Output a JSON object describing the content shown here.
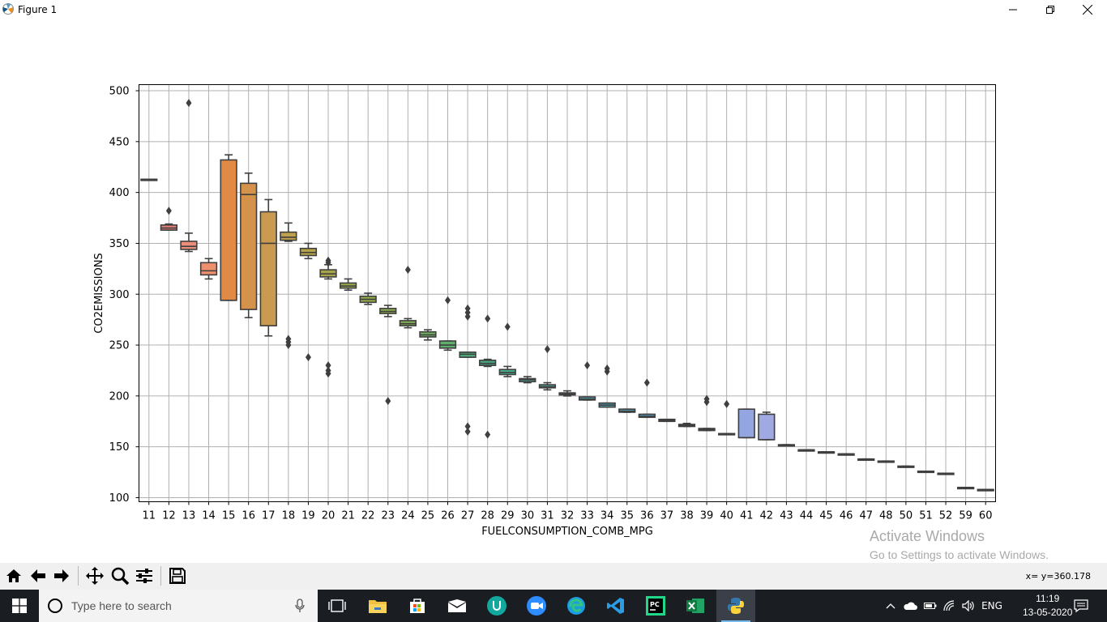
{
  "window": {
    "title": "Figure 1"
  },
  "toolbar": {
    "buttons": [
      "home-icon",
      "back-arrow-icon",
      "forward-arrow-icon",
      "pan-icon",
      "zoom-icon",
      "configure-subplots-icon",
      "save-icon"
    ],
    "coords": "x= y=360.178"
  },
  "watermark": {
    "line1": "Activate Windows",
    "line2": "Go to Settings to activate Windows."
  },
  "taskbar": {
    "search_placeholder": "Type here to search",
    "apps": [
      "task-view-icon",
      "file-explorer-icon",
      "store-icon",
      "mail-icon",
      "upwork-icon",
      "zoom-app-icon",
      "edge-icon",
      "vscode-icon",
      "pycharm-icon",
      "excel-icon",
      "python-icon"
    ],
    "language": "ENG",
    "time": "11:19",
    "date": "13-05-2020"
  },
  "chart_data": {
    "type": "box",
    "xlabel": "FUELCONSUMPTION_COMB_MPG",
    "ylabel": "CO2EMISSIONS",
    "ylim": [
      96,
      506
    ],
    "yticks": [
      100,
      150,
      200,
      250,
      300,
      350,
      400,
      450,
      500
    ],
    "grid": true,
    "categories": [
      "11",
      "12",
      "13",
      "14",
      "15",
      "16",
      "17",
      "18",
      "19",
      "20",
      "21",
      "22",
      "23",
      "24",
      "25",
      "26",
      "27",
      "28",
      "29",
      "30",
      "31",
      "32",
      "33",
      "34",
      "35",
      "36",
      "37",
      "38",
      "39",
      "40",
      "41",
      "42",
      "43",
      "44",
      "45",
      "46",
      "47",
      "48",
      "50",
      "51",
      "52",
      "59",
      "60"
    ],
    "boxes": [
      {
        "q1": 412,
        "median": 412,
        "q3": 413,
        "lo": 412,
        "hi": 413,
        "outliers": [],
        "color": "#dc5454"
      },
      {
        "q1": 363,
        "median": 365,
        "q3": 368,
        "lo": 363,
        "hi": 369,
        "outliers": [
          382
        ],
        "color": "#e8807a"
      },
      {
        "q1": 344,
        "median": 347,
        "q3": 352,
        "lo": 342,
        "hi": 360,
        "outliers": [
          488
        ],
        "color": "#ec8c7a"
      },
      {
        "q1": 319,
        "median": 323,
        "q3": 331,
        "lo": 315,
        "hi": 335,
        "outliers": [],
        "color": "#ee8f6e"
      },
      {
        "q1": 294,
        "median": 294,
        "q3": 432,
        "lo": 294,
        "hi": 437,
        "outliers": [],
        "color": "#e08a45"
      },
      {
        "q1": 285,
        "median": 398,
        "q3": 409,
        "lo": 277,
        "hi": 419,
        "outliers": [],
        "color": "#d4924b"
      },
      {
        "q1": 269,
        "median": 350,
        "q3": 381,
        "lo": 259,
        "hi": 393,
        "outliers": [],
        "color": "#c99a4f"
      },
      {
        "q1": 353,
        "median": 356,
        "q3": 361,
        "lo": 352,
        "hi": 370,
        "outliers": [
          250,
          253,
          256
        ],
        "color": "#c0a04c"
      },
      {
        "q1": 338,
        "median": 341,
        "q3": 345,
        "lo": 335,
        "hi": 350,
        "outliers": [
          238
        ],
        "color": "#b5a347"
      },
      {
        "q1": 317,
        "median": 320,
        "q3": 324,
        "lo": 315,
        "hi": 329,
        "outliers": [
          222,
          225,
          230,
          331,
          333
        ],
        "color": "#a8a549"
      },
      {
        "q1": 306,
        "median": 308,
        "q3": 311,
        "lo": 304,
        "hi": 315,
        "outliers": [],
        "color": "#9ea749"
      },
      {
        "q1": 292,
        "median": 295,
        "q3": 298,
        "lo": 290,
        "hi": 301,
        "outliers": [],
        "color": "#94a948"
      },
      {
        "q1": 281,
        "median": 283,
        "q3": 286,
        "lo": 278,
        "hi": 289,
        "outliers": [
          195
        ],
        "color": "#8aab4c"
      },
      {
        "q1": 269,
        "median": 271,
        "q3": 274,
        "lo": 267,
        "hi": 276,
        "outliers": [
          324
        ],
        "color": "#7fad51"
      },
      {
        "q1": 258,
        "median": 260,
        "q3": 263,
        "lo": 255,
        "hi": 265,
        "outliers": [],
        "color": "#6fae5e"
      },
      {
        "q1": 247,
        "median": 250,
        "q3": 254,
        "lo": 245,
        "hi": 254,
        "outliers": [
          294
        ],
        "color": "#5eaf6d"
      },
      {
        "q1": 238,
        "median": 241,
        "q3": 243,
        "lo": 238,
        "hi": 243,
        "outliers": [
          165,
          170,
          278,
          282,
          286
        ],
        "color": "#4fae7a"
      },
      {
        "q1": 230,
        "median": 232,
        "q3": 235,
        "lo": 229,
        "hi": 236,
        "outliers": [
          162,
          276
        ],
        "color": "#47ac84"
      },
      {
        "q1": 221,
        "median": 223,
        "q3": 226,
        "lo": 219,
        "hi": 229,
        "outliers": [
          268
        ],
        "color": "#44ab8d"
      },
      {
        "q1": 214,
        "median": 216,
        "q3": 217,
        "lo": 213,
        "hi": 219,
        "outliers": [],
        "color": "#45aa96"
      },
      {
        "q1": 208,
        "median": 209,
        "q3": 211,
        "lo": 206,
        "hi": 213,
        "outliers": [
          246
        ],
        "color": "#47a99e"
      },
      {
        "q1": 201,
        "median": 202,
        "q3": 203,
        "lo": 200,
        "hi": 205,
        "outliers": [],
        "color": "#48a7a7"
      },
      {
        "q1": 196,
        "median": 197,
        "q3": 199,
        "lo": 196,
        "hi": 199,
        "outliers": [
          230
        ],
        "color": "#4aa5ae"
      },
      {
        "q1": 189,
        "median": 191,
        "q3": 193,
        "lo": 189,
        "hi": 193,
        "outliers": [
          224,
          227
        ],
        "color": "#4ca3b5"
      },
      {
        "q1": 184,
        "median": 185,
        "q3": 187,
        "lo": 184,
        "hi": 187,
        "outliers": [],
        "color": "#50a1bd"
      },
      {
        "q1": 179,
        "median": 180,
        "q3": 182,
        "lo": 179,
        "hi": 182,
        "outliers": [
          213
        ],
        "color": "#569ec6"
      },
      {
        "q1": 175,
        "median": 176,
        "q3": 177,
        "lo": 175,
        "hi": 177,
        "outliers": [],
        "color": "#5e9bcf"
      },
      {
        "q1": 170,
        "median": 171,
        "q3": 172,
        "lo": 170,
        "hi": 173,
        "outliers": [],
        "color": "#6a98d8"
      },
      {
        "q1": 166,
        "median": 167,
        "q3": 168,
        "lo": 166,
        "hi": 168,
        "outliers": [
          194,
          197
        ],
        "color": "#7795df"
      },
      {
        "q1": 162,
        "median": 162,
        "q3": 163,
        "lo": 162,
        "hi": 163,
        "outliers": [
          192
        ],
        "color": "#8594e2"
      },
      {
        "q1": 159,
        "median": 159,
        "q3": 187,
        "lo": 159,
        "hi": 187,
        "outliers": [],
        "color": "#93a6e1"
      },
      {
        "q1": 157,
        "median": 157,
        "q3": 182,
        "lo": 157,
        "hi": 184,
        "outliers": [],
        "color": "#a0a9e1"
      },
      {
        "q1": 152,
        "median": 152,
        "q3": 152,
        "lo": 152,
        "hi": 152,
        "outliers": [],
        "color": "#ab9fe2"
      },
      {
        "q1": 147,
        "median": 147,
        "q3": 147,
        "lo": 147,
        "hi": 147,
        "outliers": [],
        "color": "#b39ae0"
      },
      {
        "q1": 145,
        "median": 145,
        "q3": 145,
        "lo": 145,
        "hi": 145,
        "outliers": [],
        "color": "#bb94dd"
      },
      {
        "q1": 143,
        "median": 143,
        "q3": 143,
        "lo": 143,
        "hi": 143,
        "outliers": [],
        "color": "#c590da"
      },
      {
        "q1": 138,
        "median": 138,
        "q3": 138,
        "lo": 138,
        "hi": 138,
        "outliers": [],
        "color": "#cd8cd6"
      },
      {
        "q1": 136,
        "median": 136,
        "q3": 136,
        "lo": 136,
        "hi": 136,
        "outliers": [],
        "color": "#d389d0"
      },
      {
        "q1": 130,
        "median": 130,
        "q3": 131,
        "lo": 130,
        "hi": 131,
        "outliers": [],
        "color": "#d985c9"
      },
      {
        "q1": 126,
        "median": 126,
        "q3": 126,
        "lo": 126,
        "hi": 126,
        "outliers": [],
        "color": "#df82c0"
      },
      {
        "q1": 124,
        "median": 124,
        "q3": 124,
        "lo": 124,
        "hi": 124,
        "outliers": [],
        "color": "#e37fb6"
      },
      {
        "q1": 110,
        "median": 110,
        "q3": 110,
        "lo": 110,
        "hi": 110,
        "outliers": [],
        "color": "#e67dab"
      },
      {
        "q1": 108,
        "median": 108,
        "q3": 108,
        "lo": 108,
        "hi": 108,
        "outliers": [],
        "color": "#e97ba0"
      }
    ]
  }
}
